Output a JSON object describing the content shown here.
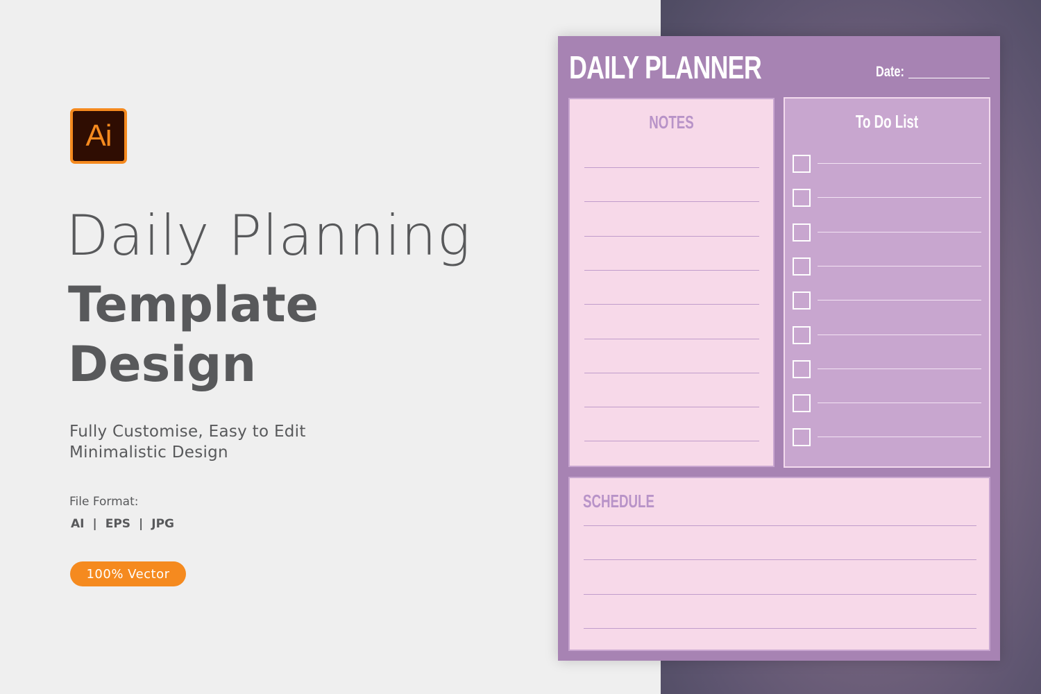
{
  "promo": {
    "app_icon": {
      "name": "adobe-illustrator-icon",
      "text": "Ai",
      "accent": "#f58a1f",
      "bg": "#2f0d02"
    },
    "headline_light": "Daily Planning",
    "headline_bold_1": "Template",
    "headline_bold_2": "Design",
    "subtitle_1": "Fully Customise, Easy to Edit",
    "subtitle_2": "Minimalistic Design",
    "file_format_label": "File Format:",
    "formats": [
      "AI",
      "EPS",
      "JPG"
    ],
    "separator": "|",
    "badge": "100% Vector"
  },
  "planner": {
    "title": "DAILY PLANNER",
    "date_label": "Date:",
    "notes": {
      "title": "NOTES",
      "line_count": 9
    },
    "todo": {
      "title": "To Do List",
      "item_count": 9
    },
    "schedule": {
      "title": "SCHEDULE",
      "line_count": 4
    },
    "colors": {
      "frame": "#a783b3",
      "light_panel": "#f7d9e9",
      "todo_panel": "#c8a6cf",
      "accent_text": "#b893c8"
    }
  }
}
